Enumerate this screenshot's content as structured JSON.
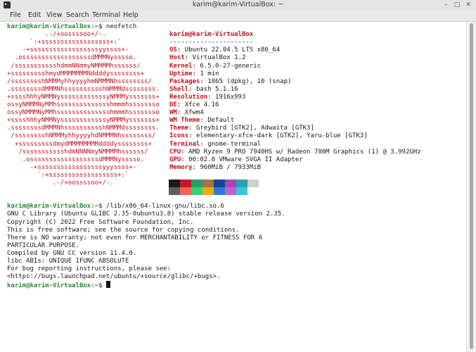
{
  "window": {
    "title": "karim@karim-VirtualBox: ~"
  },
  "menubar": [
    "File",
    "Edit",
    "View",
    "Search",
    "Terminal",
    "Help"
  ],
  "prompt": {
    "user_host": "karim@karim-VirtualBox",
    "sep": ":",
    "path": "~",
    "symbol": "$ "
  },
  "commands": {
    "first": "neofetch",
    "second": "/lib/x86_64-linux-gnu/libc.so.6"
  },
  "neofetch": {
    "logo": [
      "          .-/+oossssoo+/-.",
      "      `:+ssssssssssssssssss+:`",
      "    -+ssssssssssssssssssyyssss+-",
      "  .ossssssssssssssssssdMMMNysssso.",
      " /ssssssssssshdmmNNmmyNMMMMhssssss/",
      "+ssssssssshmydMMMMMMMNddddyssssssss+",
      "/sssssssshNMMMyhhyyyyhmNMMMNhssssssss/",
      ".ssssssssdMMMNhsssssssssshNMMMdssssssss.",
      "+sssshhhyNMMNyssssssssssssyNMMMysssssss+",
      "ossyNMMMNyMMhsssssssssssssshmmmhssssssso",
      "ossyNMMMNyMMhsssssssssssssshmmmhssssssso",
      "+sssshhhyNMMNyssssssssssssyNMMMysssssss+",
      ".ssssssssdMMMNhsssssssssshNMMMdssssssss.",
      " /sssssssshNMMMyhhyyyyhdNMMMNhssssssss/",
      "  +sssssssssdmydMMMMMMMMddddyssssssss+",
      "   /ssssssssssshdmNNNNmyNMMMMhssssss/",
      "    .ossssssssssssssssssdMMMNysssso.",
      "      -+sssssssssssssssssyyyssss+-",
      "        `:+ssssssssssssssssss+:`",
      "            .-/+oossssoo+/-."
    ],
    "header": "karim@karim-VirtualBox",
    "underline": "----------------------",
    "info": [
      {
        "key": "OS",
        "value": "Ubuntu 22.04.5 LTS x86_64"
      },
      {
        "key": "Host",
        "value": "VirtualBox 1.2"
      },
      {
        "key": "Kernel",
        "value": "6.5.0-27-generic"
      },
      {
        "key": "Uptime",
        "value": "1 min"
      },
      {
        "key": "Packages",
        "value": "1865 (dpkg), 10 (snap)"
      },
      {
        "key": "Shell",
        "value": "bash 5.1.16"
      },
      {
        "key": "Resolution",
        "value": "1916x993"
      },
      {
        "key": "DE",
        "value": "Xfce 4.16"
      },
      {
        "key": "WM",
        "value": "Xfwm4"
      },
      {
        "key": "WM Theme",
        "value": "Default"
      },
      {
        "key": "Theme",
        "value": "Greybird [GTK2], Adwaita [GTK3]"
      },
      {
        "key": "Icons",
        "value": "elementary-xfce-dark [GTK2], Yaru-blue [GTK3]"
      },
      {
        "key": "Terminal",
        "value": "gnome-terminal"
      },
      {
        "key": "CPU",
        "value": "AMD Ryzen 9 PRO 7940HS w/ Radeon 780M Graphics (1) @ 3.992GHz"
      },
      {
        "key": "GPU",
        "value": "00:02.0 VMware SVGA II Adapter"
      },
      {
        "key": "Memory",
        "value": "960MiB / 7933MiB"
      }
    ],
    "palette_top": [
      "#1b1b1b",
      "#c01c28",
      "#26a269",
      "#a2734c",
      "#12488b",
      "#a347ba",
      "#2aa1b3",
      "#d0cfcc"
    ],
    "palette_bottom": [
      "#5e5c64",
      "#f66151",
      "#33d17a",
      "#e9ad0c",
      "#2a7bde",
      "#c061cb",
      "#33c7de",
      "#ffffff"
    ]
  },
  "libc_output": [
    "GNU C Library (Ubuntu GLIBC 2.35-0ubuntu3.8) stable release version 2.35.",
    "Copyright (C) 2022 Free Software Foundation, Inc.",
    "This is free software; see the source for copying conditions.",
    "There is NO warranty; not even for MERCHANTABILITY or FITNESS FOR A",
    "PARTICULAR PURPOSE.",
    "Compiled by GNU CC version 11.4.0.",
    "libc ABIs: UNIQUE IFUNC ABSOLUTE",
    "For bug reporting instructions, please see:",
    "<https://bugs.launchpad.net/ubuntu/+source/glibc/+bugs>."
  ],
  "icons": {
    "app": "terminal-icon",
    "minimize": "minimize-icon",
    "maximize": "maximize-icon",
    "close": "close-icon"
  }
}
